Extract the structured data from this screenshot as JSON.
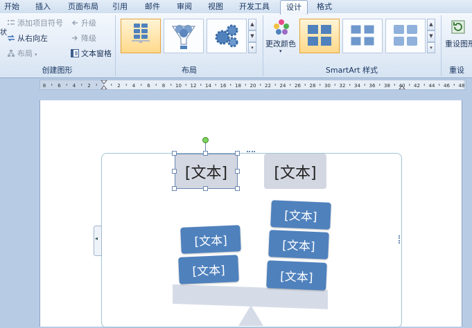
{
  "tabs": [
    "开始",
    "插入",
    "页面布局",
    "引用",
    "邮件",
    "审阅",
    "视图",
    "开发工具",
    "设计",
    "格式"
  ],
  "create_group": {
    "label": "创建图形",
    "add_bullet": "添加项目符号",
    "right_to_left": "从右向左",
    "layout": "布局",
    "promote": "升级",
    "demote": "降级",
    "text_pane": "文本窗格",
    "partial_left": "状"
  },
  "layout_group": {
    "label": "布局"
  },
  "styles_group": {
    "label": "SmartArt 样式",
    "change_colors": "更改颜色"
  },
  "reset_group": {
    "label": "重设",
    "reset_graphic": "重设图形"
  },
  "ruler": {
    "left_ticks": [
      "8",
      "6",
      "4",
      "2"
    ],
    "right_ticks": [
      "2",
      "4",
      "6",
      "8",
      "10",
      "12",
      "14",
      "16",
      "18",
      "20",
      "22",
      "24",
      "26",
      "28",
      "30",
      "32",
      "34",
      "36",
      "38",
      "40",
      "42",
      "44",
      "46",
      "48"
    ]
  },
  "diagram": {
    "top_left": "[文本]",
    "top_right": "[文本]",
    "left_items": [
      "[文本]",
      "[文本]"
    ],
    "right_items": [
      "[文本]",
      "[文本]",
      "[文本]"
    ]
  },
  "colors": {
    "accent": "#4f81bd",
    "top_box": "#d3d7e1",
    "beam": "#d6dce7"
  }
}
